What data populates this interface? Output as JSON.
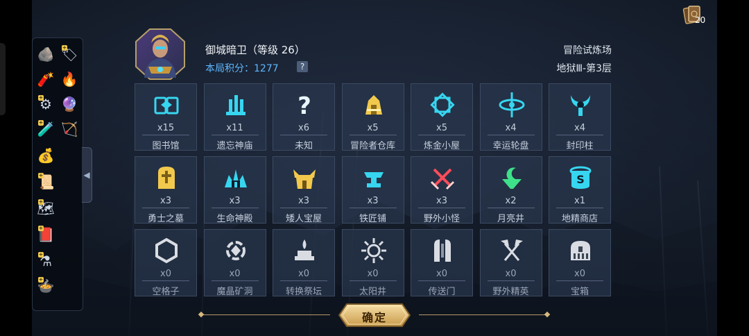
{
  "topbar": {
    "card_count": "20"
  },
  "character": {
    "name": "御城暗卫（等级 26）",
    "score_text": "本局积分：1277",
    "help_label": "?"
  },
  "stage": {
    "name": "冒险试炼场",
    "floor": "地狱Ⅲ-第3层"
  },
  "colors": {
    "accent_cyan": "#37d6f0",
    "accent_gold": "#f2c94c",
    "accent_red": "#ff4d5a",
    "accent_green": "#3ee08a",
    "gray_icon": "#d9dde3"
  },
  "tiles": [
    {
      "name": "图书馆",
      "count": "x15",
      "icon": "book-icon",
      "color": "#37d6f0"
    },
    {
      "name": "遗忘神庙",
      "count": "x11",
      "icon": "temple-icon",
      "color": "#37d6f0"
    },
    {
      "name": "未知",
      "count": "x6",
      "icon": "question-icon",
      "color": "#e8f6ff"
    },
    {
      "name": "冒险者仓库",
      "count": "x5",
      "icon": "warehouse-icon",
      "color": "#f2c94c"
    },
    {
      "name": "炼金小屋",
      "count": "x5",
      "icon": "alchemy-icon",
      "color": "#37d6f0"
    },
    {
      "name": "幸运轮盘",
      "count": "x4",
      "icon": "wheel-icon",
      "color": "#37d6f0"
    },
    {
      "name": "封印柱",
      "count": "x4",
      "icon": "seal-pillar-icon",
      "color": "#37d6f0"
    },
    {
      "name": "勇士之墓",
      "count": "x3",
      "icon": "tomb-icon",
      "color": "#f2c94c"
    },
    {
      "name": "生命神殿",
      "count": "x3",
      "icon": "life-temple-icon",
      "color": "#37d6f0"
    },
    {
      "name": "矮人宝屋",
      "count": "x3",
      "icon": "dwarf-house-icon",
      "color": "#f2c94c"
    },
    {
      "name": "铁匠铺",
      "count": "x3",
      "icon": "anvil-icon",
      "color": "#37d6f0"
    },
    {
      "name": "野外小怪",
      "count": "x3",
      "icon": "crossed-swords-icon",
      "color": "#ff4d5a"
    },
    {
      "name": "月亮井",
      "count": "x2",
      "icon": "moon-well-icon",
      "color": "#3ee08a"
    },
    {
      "name": "地精商店",
      "count": "x1",
      "icon": "goblin-shop-icon",
      "color": "#37d6f0"
    },
    {
      "name": "空格子",
      "count": "x0",
      "icon": "hexagon-icon",
      "color": "#d9dde3"
    },
    {
      "name": "魔晶矿洞",
      "count": "x0",
      "icon": "crystal-mine-icon",
      "color": "#d9dde3"
    },
    {
      "name": "转换祭坛",
      "count": "x0",
      "icon": "altar-icon",
      "color": "#d9dde3"
    },
    {
      "name": "太阳井",
      "count": "x0",
      "icon": "sun-well-icon",
      "color": "#d9dde3"
    },
    {
      "name": "传送门",
      "count": "x0",
      "icon": "portal-icon",
      "color": "#d9dde3"
    },
    {
      "name": "野外精英",
      "count": "x0",
      "icon": "crossed-axes-icon",
      "color": "#d9dde3"
    },
    {
      "name": "宝箱",
      "count": "x0",
      "icon": "chest-icon",
      "color": "#d9dde3"
    }
  ],
  "inventory": [
    {
      "icon": "stone-icon",
      "plus": false
    },
    {
      "icon": "scroll-tag-icon",
      "plus": true
    },
    {
      "icon": "dynamite-icon",
      "plus": false
    },
    {
      "icon": "torch-hand-icon",
      "plus": false
    },
    {
      "icon": "gear-bundle-icon",
      "plus": true
    },
    {
      "icon": "magic-orb-icon",
      "plus": false
    },
    {
      "icon": "red-potion-icon",
      "plus": true
    },
    {
      "icon": "slingshot-icon",
      "plus": false
    },
    {
      "icon": "money-bag-icon",
      "plus": false
    },
    {
      "icon": "tablet-icon",
      "plus": true
    },
    {
      "icon": "map-scroll-icon",
      "plus": true
    },
    {
      "icon": "spellbook-icon",
      "plus": true
    },
    {
      "icon": "potion-set-icon",
      "plus": true
    },
    {
      "icon": "cauldron-icon",
      "plus": true
    }
  ],
  "footer": {
    "confirm_label": "确定"
  }
}
